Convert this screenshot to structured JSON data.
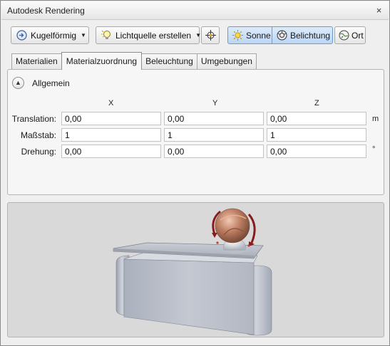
{
  "window": {
    "title": "Autodesk Rendering",
    "close_glyph": "×"
  },
  "toolbar": {
    "mapping_label": "Kugelförmig",
    "create_light_label": "Lichtquelle erstellen",
    "sun_label": "Sonne",
    "exposure_label": "Belichtung",
    "location_label": "Ort"
  },
  "tabs": [
    {
      "label": "Materialien"
    },
    {
      "label": "Materialzuordnung"
    },
    {
      "label": "Beleuchtung"
    },
    {
      "label": "Umgebungen"
    }
  ],
  "general": {
    "title": "Allgemein",
    "columns": {
      "x": "X",
      "y": "Y",
      "z": "Z"
    },
    "rows": [
      {
        "label": "Translation:",
        "x": "0,00",
        "y": "0,00",
        "z": "0,00",
        "unit": "m"
      },
      {
        "label": "Maßstab:",
        "x": "1",
        "y": "1",
        "z": "1",
        "unit": ""
      },
      {
        "label": "Drehung:",
        "x": "0,00",
        "y": "0,00",
        "z": "0,00",
        "unit": "°"
      }
    ]
  },
  "icons": {
    "mapping": "sphere-mapping-icon",
    "create_light": "light-bulb-icon",
    "target": "crosshair-icon",
    "sun": "sun-icon",
    "exposure": "exposure-icon",
    "location": "globe-icon",
    "collapse": "chevron-up-icon"
  },
  "colors": {
    "active_toggle": "#bcd6f4",
    "rotate_arrow": "#8b1a1a",
    "sphere": "#b06a4a"
  }
}
